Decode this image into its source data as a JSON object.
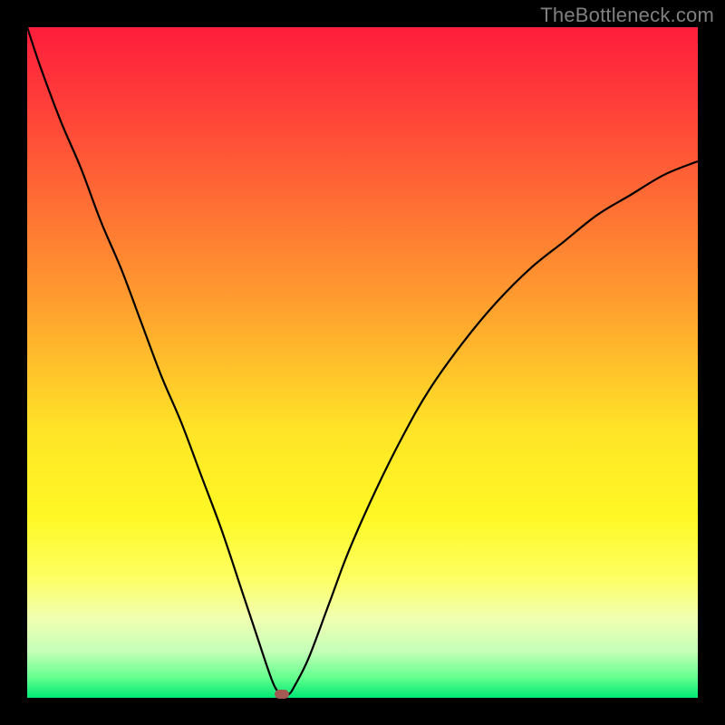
{
  "watermark": "TheBottleneck.com",
  "chart_data": {
    "type": "line",
    "title": "",
    "xlabel": "",
    "ylabel": "",
    "xlim": [
      0,
      100
    ],
    "ylim": [
      0,
      100
    ],
    "x": [
      0,
      2,
      5,
      8,
      11,
      14,
      17,
      20,
      23,
      26,
      29,
      32,
      34,
      36,
      37,
      38,
      39,
      40,
      42,
      45,
      48,
      52,
      56,
      60,
      65,
      70,
      75,
      80,
      85,
      90,
      95,
      100
    ],
    "values": [
      100,
      94,
      86,
      79,
      71,
      64,
      56,
      48,
      41,
      33,
      25,
      16,
      10,
      4,
      1.5,
      0.5,
      0.5,
      2,
      6,
      14,
      22,
      31,
      39,
      46,
      53,
      59,
      64,
      68,
      72,
      75,
      78,
      80
    ],
    "min_point": {
      "x": 38,
      "y": 0.5
    },
    "gradient": {
      "top_color": "#ff1e3c",
      "mid_color": "#ffe427",
      "bottom_color": "#00e874"
    }
  }
}
